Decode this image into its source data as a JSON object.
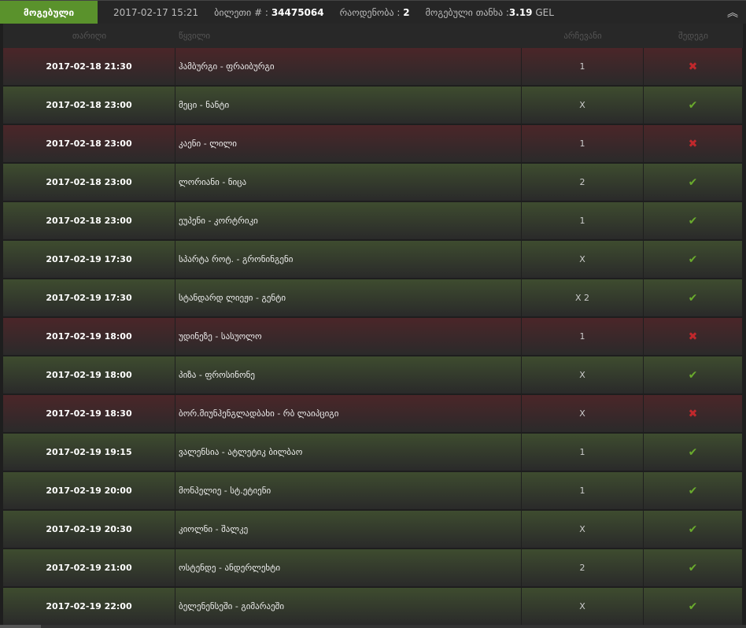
{
  "header": {
    "tab_label": "მოგებული",
    "datetime": "2017-02-17 15:21",
    "ticket_label": "ბილეთი # :",
    "ticket_number": "34475064",
    "count_label": "რაოდენობა :",
    "count_value": "2",
    "amount_label": "მოგებული თანხა :",
    "amount_value": "3.19",
    "currency": "GEL",
    "collapse_icon": "double-chevron-up-icon"
  },
  "columns": [
    "თარიღი",
    "წყვილი",
    "არჩევანი",
    "შედეგი"
  ],
  "colors": {
    "accent": "#5a922c",
    "won": "#6aab2d",
    "lost": "#c0282c"
  },
  "rows": [
    {
      "date": "2017-02-18 21:30",
      "pair": "ჰამბურგი - ფრაიბურგი",
      "choice": "1",
      "result": "lost"
    },
    {
      "date": "2017-02-18 23:00",
      "pair": "მეცი - ნანტი",
      "choice": "X",
      "result": "won"
    },
    {
      "date": "2017-02-18 23:00",
      "pair": "კაენი - ლილი",
      "choice": "1",
      "result": "lost"
    },
    {
      "date": "2017-02-18 23:00",
      "pair": "ლორიანი - ნიცა",
      "choice": "2",
      "result": "won"
    },
    {
      "date": "2017-02-18 23:00",
      "pair": "ეუპენი - კორტრიკი",
      "choice": "1",
      "result": "won"
    },
    {
      "date": "2017-02-19 17:30",
      "pair": "სპარტა როტ. - გრონინგენი",
      "choice": "X",
      "result": "won"
    },
    {
      "date": "2017-02-19 17:30",
      "pair": "სტანდარდ ლიეჟი - გენტი",
      "choice": "X 2",
      "result": "won"
    },
    {
      "date": "2017-02-19 18:00",
      "pair": "უდინეზე - სასუოლო",
      "choice": "1",
      "result": "lost"
    },
    {
      "date": "2017-02-19 18:00",
      "pair": "პიზა - ფროსინონე",
      "choice": "X",
      "result": "won"
    },
    {
      "date": "2017-02-19 18:30",
      "pair": "ბორ.მიუნჰენგლადბახი - რბ ლაიპციგი",
      "choice": "X",
      "result": "lost"
    },
    {
      "date": "2017-02-19 19:15",
      "pair": "ვალენსია - ატლეტიკ ბილბაო",
      "choice": "1",
      "result": "won"
    },
    {
      "date": "2017-02-19 20:00",
      "pair": "მონპელიე - სტ.ეტიენი",
      "choice": "1",
      "result": "won"
    },
    {
      "date": "2017-02-19 20:30",
      "pair": "კიოლნი - შალკე",
      "choice": "X",
      "result": "won"
    },
    {
      "date": "2017-02-19 21:00",
      "pair": "ოსტენდე - ანდერლეხტი",
      "choice": "2",
      "result": "won"
    },
    {
      "date": "2017-02-19 22:00",
      "pair": "ბელენენსეში - გიმარაეში",
      "choice": "X",
      "result": "won"
    }
  ]
}
